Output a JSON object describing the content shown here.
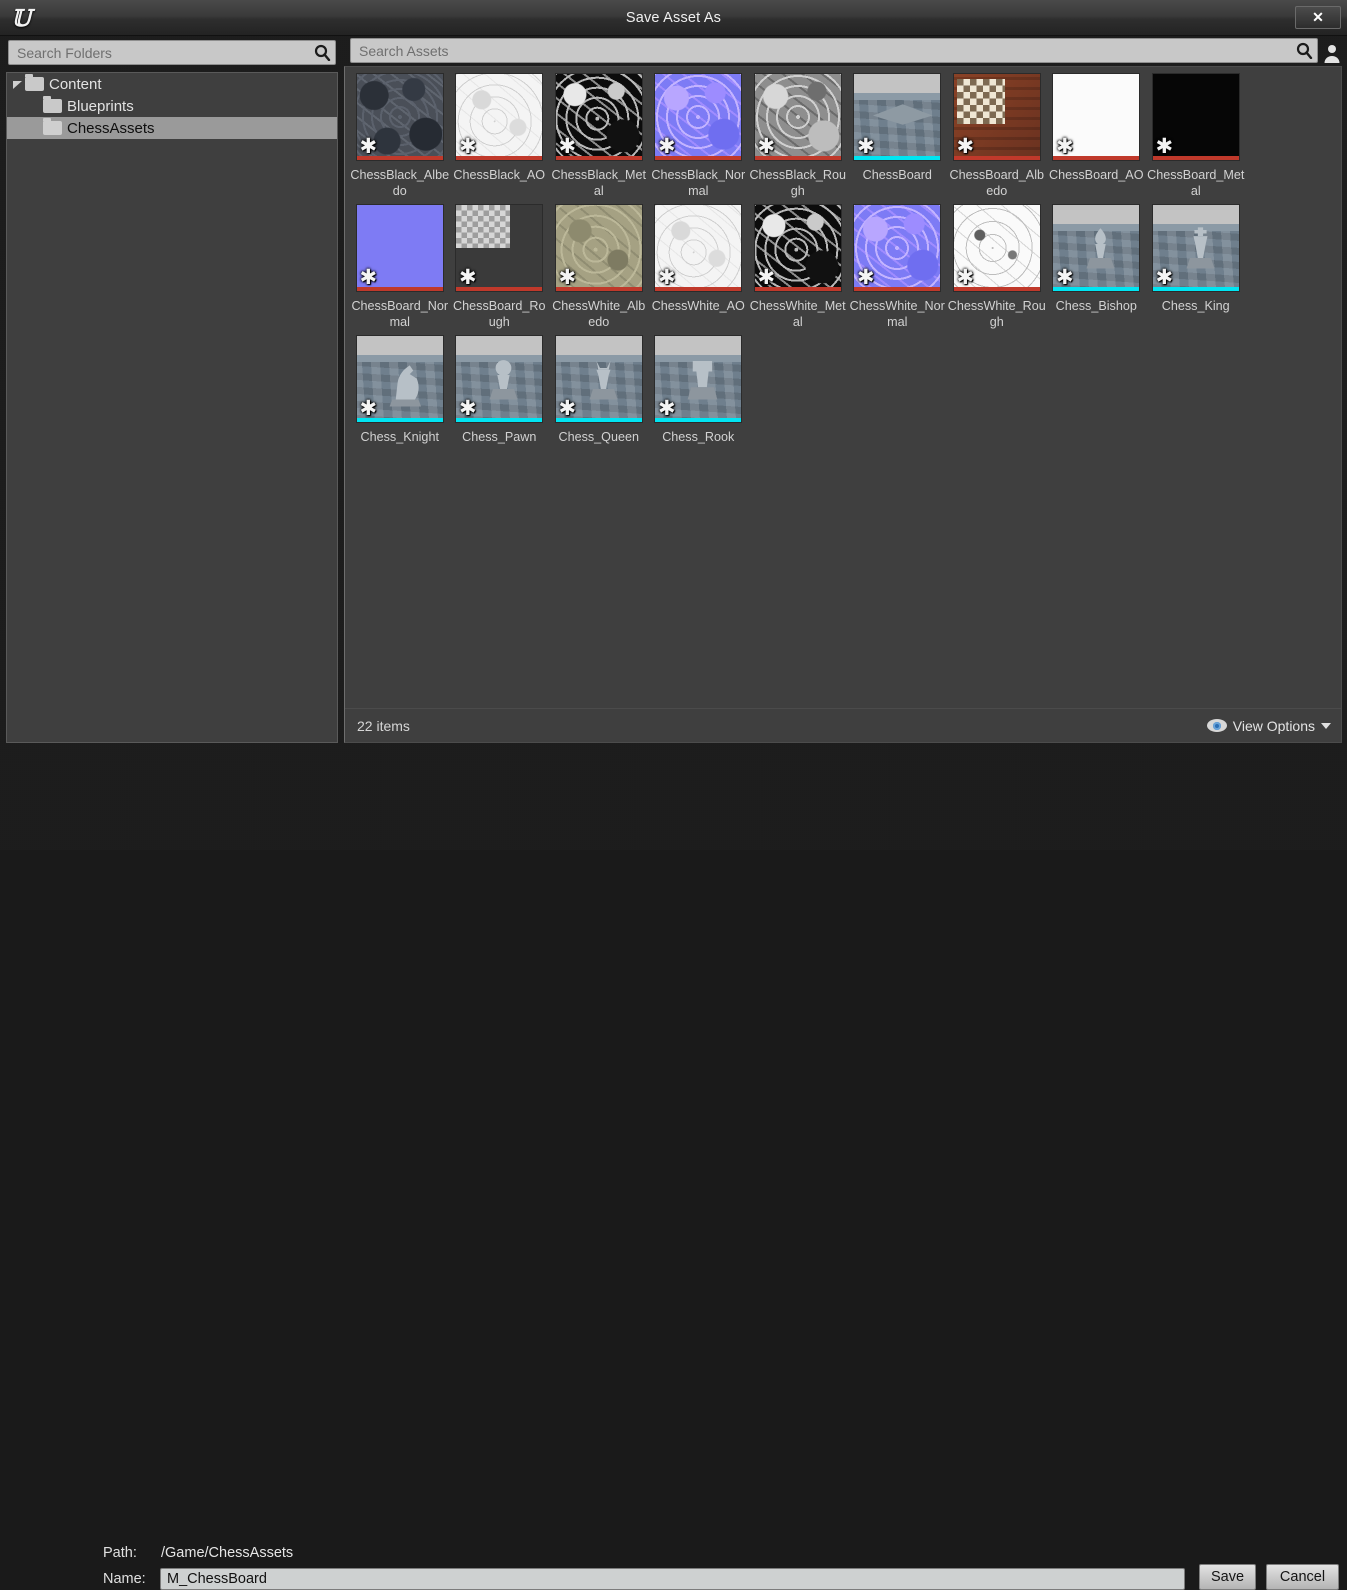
{
  "window": {
    "title": "Save Asset As",
    "logo_icon": "unreal-engine-logo",
    "close_label": "✕"
  },
  "folder_search": {
    "placeholder": "Search Folders",
    "value": "",
    "icon": "search-icon"
  },
  "asset_search": {
    "placeholder": "Search Assets",
    "value": "",
    "icon": "search-icon",
    "profile_icon": "user-icon"
  },
  "folder_tree": [
    {
      "label": "Content",
      "depth": 0,
      "expanded": true,
      "selected": false
    },
    {
      "label": "Blueprints",
      "depth": 1,
      "expanded": false,
      "selected": false
    },
    {
      "label": "ChessAssets",
      "depth": 1,
      "expanded": false,
      "selected": true
    }
  ],
  "assets": [
    {
      "label": "ChessBlack_Albedo",
      "type": "texture",
      "bar": "#c0392b",
      "art": "t-swirl-dark",
      "dirty": true
    },
    {
      "label": "ChessBlack_AO",
      "type": "texture",
      "bar": "#c0392b",
      "art": "t-swirl-white",
      "dirty": true
    },
    {
      "label": "ChessBlack_Metal",
      "type": "texture",
      "bar": "#c0392b",
      "art": "t-swirl-black",
      "dirty": true
    },
    {
      "label": "ChessBlack_Normal",
      "type": "texture",
      "bar": "#c0392b",
      "art": "t-swirl-normal",
      "dirty": true
    },
    {
      "label": "ChessBlack_Rough",
      "type": "texture",
      "bar": "#c0392b",
      "art": "t-swirl-gray",
      "dirty": true
    },
    {
      "label": "ChessBoard",
      "type": "staticmesh",
      "bar": "#00e5f2",
      "art": "t-3dview",
      "dirty": true,
      "piece": "board"
    },
    {
      "label": "ChessBoard_Albedo",
      "type": "texture",
      "bar": "#c0392b",
      "art": "t-board-albedo",
      "dirty": true,
      "checker": "wood"
    },
    {
      "label": "ChessBoard_AO",
      "type": "texture",
      "bar": "#c0392b",
      "art": "t-board-ao",
      "dirty": true
    },
    {
      "label": "ChessBoard_Metal",
      "type": "texture",
      "bar": "#c0392b",
      "art": "t-board-metal",
      "dirty": true
    },
    {
      "label": "ChessBoard_Normal",
      "type": "texture",
      "bar": "#c0392b",
      "art": "t-board-normal",
      "dirty": true
    },
    {
      "label": "ChessBoard_Rough",
      "type": "texture",
      "bar": "#c0392b",
      "art": "t-board-rough",
      "dirty": true,
      "checker": "gray"
    },
    {
      "label": "ChessWhite_Albedo",
      "type": "texture",
      "bar": "#c0392b",
      "art": "t-swirl-tan",
      "dirty": true
    },
    {
      "label": "ChessWhite_AO",
      "type": "texture",
      "bar": "#c0392b",
      "art": "t-swirl-white",
      "dirty": true
    },
    {
      "label": "ChessWhite_Metal",
      "type": "texture",
      "bar": "#c0392b",
      "art": "t-swirl-black",
      "dirty": true
    },
    {
      "label": "ChessWhite_Normal",
      "type": "texture",
      "bar": "#c0392b",
      "art": "t-swirl-normal",
      "dirty": true
    },
    {
      "label": "ChessWhite_Rough",
      "type": "texture",
      "bar": "#c0392b",
      "art": "t-swirl-metalw",
      "dirty": true
    },
    {
      "label": "Chess_Bishop",
      "type": "staticmesh",
      "bar": "#00e5f2",
      "art": "t-3dview",
      "dirty": true,
      "piece": "bishop"
    },
    {
      "label": "Chess_King",
      "type": "staticmesh",
      "bar": "#00e5f2",
      "art": "t-3dview",
      "dirty": true,
      "piece": "king"
    },
    {
      "label": "Chess_Knight",
      "type": "staticmesh",
      "bar": "#00e5f2",
      "art": "t-3dview",
      "dirty": true,
      "piece": "knight"
    },
    {
      "label": "Chess_Pawn",
      "type": "staticmesh",
      "bar": "#00e5f2",
      "art": "t-3dview",
      "dirty": true,
      "piece": "pawn"
    },
    {
      "label": "Chess_Queen",
      "type": "staticmesh",
      "bar": "#00e5f2",
      "art": "t-3dview",
      "dirty": true,
      "piece": "queen"
    },
    {
      "label": "Chess_Rook",
      "type": "staticmesh",
      "bar": "#00e5f2",
      "art": "t-3dview",
      "dirty": true,
      "piece": "rook"
    }
  ],
  "status": {
    "item_count": "22 items",
    "view_options_label": "View Options",
    "eye_icon": "eye-icon",
    "caret_icon": "chevron-down-icon"
  },
  "footer": {
    "path_label": "Path:",
    "path_value": "/Game/ChessAssets",
    "name_label": "Name:",
    "name_value": "M_ChessBoard",
    "name_placeholder": "",
    "save_label": "Save",
    "cancel_label": "Cancel"
  },
  "colors": {
    "texture_bar": "#c0392b",
    "mesh_bar": "#00e5f2",
    "panel_bg": "#3f3f3f",
    "selection": "#9a9a9a"
  }
}
